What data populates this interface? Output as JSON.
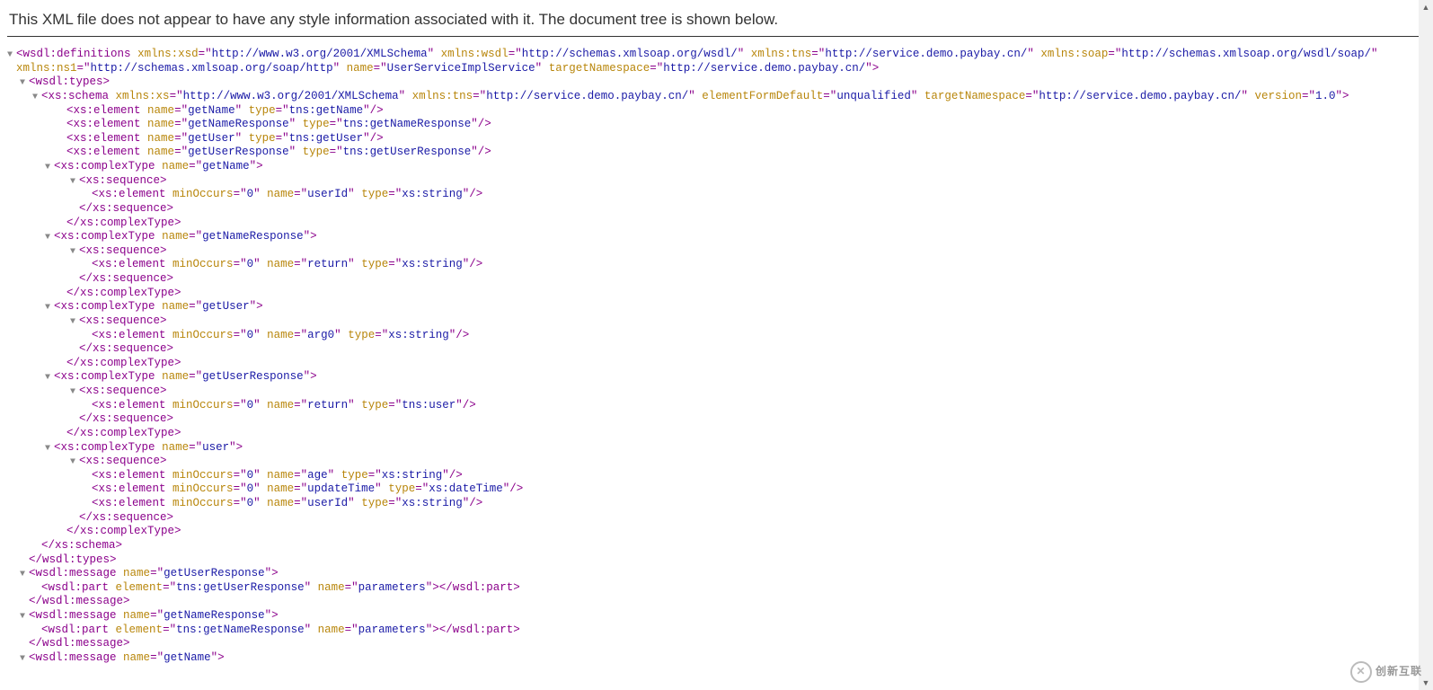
{
  "header": {
    "message": "This XML file does not appear to have any style information associated with it. The document tree is shown below."
  },
  "toggle_glyph": "▼",
  "tree": {
    "definitions": {
      "tag": "wsdl:definitions",
      "attrs": {
        "xmlns_xsd_name": "xmlns:xsd",
        "xmlns_xsd_val": "http://www.w3.org/2001/XMLSchema",
        "xmlns_wsdl_name": "xmlns:wsdl",
        "xmlns_wsdl_val": "http://schemas.xmlsoap.org/wsdl/",
        "xmlns_tns_name": "xmlns:tns",
        "xmlns_tns_val": "http://service.demo.paybay.cn/",
        "xmlns_soap_name": "xmlns:soap",
        "xmlns_soap_val": "http://schemas.xmlsoap.org/wsdl/soap/",
        "xmlns_ns1_name": "xmlns:ns1",
        "xmlns_ns1_val": "http://schemas.xmlsoap.org/soap/http",
        "name_attr": "name",
        "name_val": "UserServiceImplService",
        "tns_attr": "targetNamespace",
        "tns_val": "http://service.demo.paybay.cn/"
      }
    },
    "types_open": "wsdl:types",
    "types_close": "/wsdl:types",
    "schema": {
      "tag": "xs:schema",
      "close": "/xs:schema",
      "attrs": {
        "xmlns_xs_name": "xmlns:xs",
        "xmlns_xs_val": "http://www.w3.org/2001/XMLSchema",
        "xmlns_tns_name": "xmlns:tns",
        "xmlns_tns_val": "http://service.demo.paybay.cn/",
        "efd_name": "elementFormDefault",
        "efd_val": "unqualified",
        "tns_name": "targetNamespace",
        "tns_val": "http://service.demo.paybay.cn/",
        "ver_name": "version",
        "ver_val": "1.0"
      }
    },
    "el": {
      "tag": "xs:element",
      "name_attr": "name",
      "type_attr": "type",
      "minOccurs_attr": "minOccurs",
      "minOccurs_val": "0",
      "getName_name": "getName",
      "getName_type": "tns:getName",
      "getNameResponse_name": "getNameResponse",
      "getNameResponse_type": "tns:getNameResponse",
      "getUser_name": "getUser",
      "getUser_type": "tns:getUser",
      "getUserResponse_name": "getUserResponse",
      "getUserResponse_type": "tns:getUserResponse"
    },
    "ct": {
      "open": "xs:complexType",
      "close": "/xs:complexType",
      "name_attr": "name",
      "getName": "getName",
      "getNameResponse": "getNameResponse",
      "getUser": "getUser",
      "getUserResponse": "getUserResponse",
      "user": "user"
    },
    "seq": {
      "open": "xs:sequence",
      "close": "/xs:sequence"
    },
    "ctel": {
      "userId_name": "userId",
      "userId_type": "xs:string",
      "return_name": "return",
      "return_type_string": "xs:string",
      "arg0_name": "arg0",
      "arg0_type": "xs:string",
      "return_type_user": "tns:user",
      "age_name": "age",
      "age_type": "xs:string",
      "updateTime_name": "updateTime",
      "updateTime_type": "xs:dateTime"
    },
    "message": {
      "open": "wsdl:message",
      "close": "/wsdl:message",
      "name_attr": "name",
      "part_open": "wsdl:part",
      "part_close": "/wsdl:part",
      "element_attr": "element",
      "part_name_attr": "name",
      "part_name_val": "parameters",
      "getUserResponse_name": "getUserResponse",
      "getUserResponse_element": "tns:getUserResponse",
      "getNameResponse_name": "getNameResponse",
      "getNameResponse_element": "tns:getNameResponse",
      "getName_name": "getName"
    }
  },
  "watermark": "创新互联"
}
